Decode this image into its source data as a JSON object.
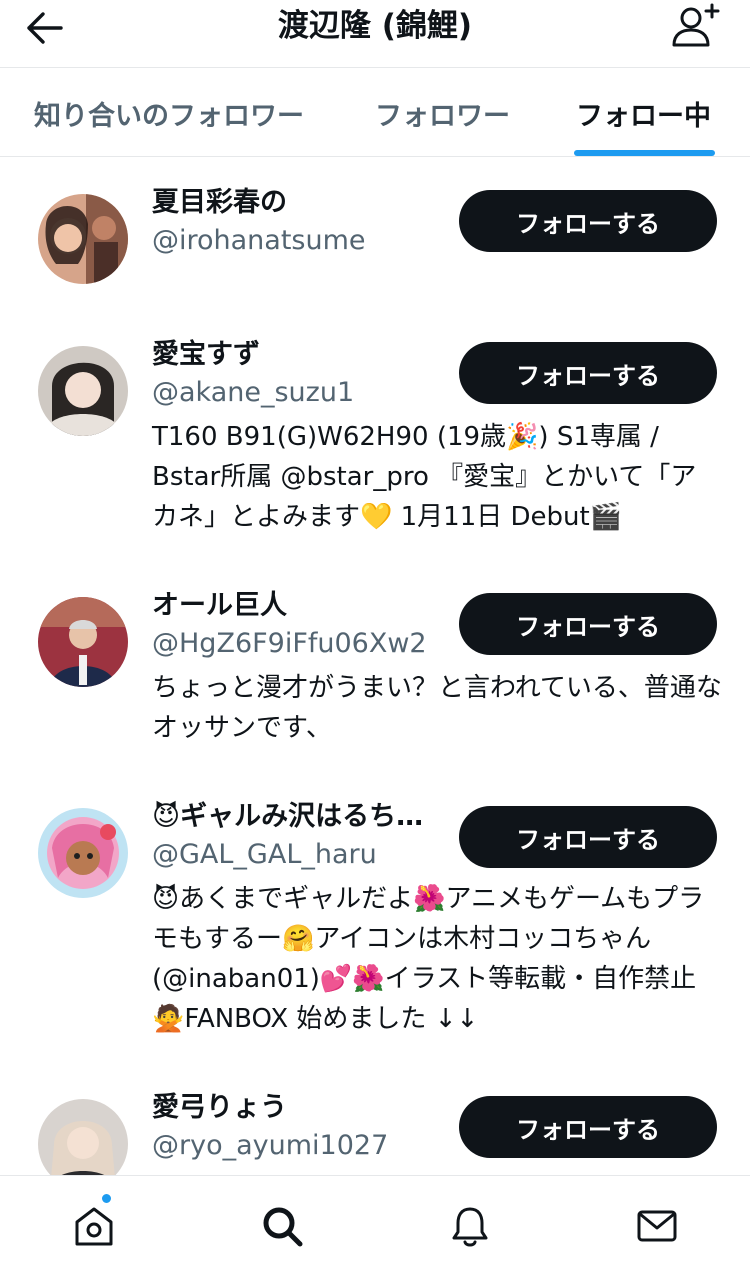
{
  "header": {
    "title": "渡辺隆 (錦鯉)",
    "back_icon": "arrow-left-icon",
    "add_icon": "add-user-icon"
  },
  "tabs": [
    {
      "label": "知り合いのフォロワー",
      "active": false
    },
    {
      "label": "フォロワー",
      "active": false
    },
    {
      "label": "フォロー中",
      "active": true
    }
  ],
  "users": [
    {
      "name": "夏目彩春の",
      "handle": "@irohanatsume",
      "bio": "",
      "button": "フォローする",
      "avatar_color": "#c9825f"
    },
    {
      "name": "愛宝すず",
      "handle": "@akane_suzu1",
      "bio": "T160 B91(G)W62H90 (19歳🎉) S1専属 / Bstar所属 @bstar_pro 『愛宝』とかいて「アカネ」とよみます💛 1月11日 Debut🎬",
      "button": "フォローする",
      "avatar_color": "#b9b3ad"
    },
    {
      "name": "オール巨人",
      "handle": "@HgZ6F9iFfu06Xw2",
      "bio": "ちょっと漫才がうまい？と言われている、普通なオッサンです、",
      "button": "フォローする",
      "avatar_color": "#8c2f3a"
    },
    {
      "name": "😈ギャルみ沢はるち…",
      "handle": "@GAL_GAL_haru",
      "bio": "😈あくまでギャルだよ🌺アニメもゲームもプラモもするー🤗アイコンは木村コッコちゃん (@inaban01)💕🌺イラスト等転載・自作禁止🙅FANBOX 始めました ↓↓",
      "button": "フォローする",
      "avatar_color": "#e98fb8"
    },
    {
      "name": "愛弓りょう",
      "handle": "@ryo_ayumi1027",
      "bio": "",
      "button": "フォローする",
      "avatar_color": "#7a6f6c"
    }
  ],
  "bottom_nav": [
    {
      "icon": "home-icon",
      "badge": true
    },
    {
      "icon": "search-icon",
      "badge": false
    },
    {
      "icon": "bell-icon",
      "badge": false
    },
    {
      "icon": "mail-icon",
      "badge": false
    }
  ],
  "colors": {
    "accent": "#1d9bf0",
    "button_bg": "#0f1419",
    "secondary_text": "#536471"
  }
}
